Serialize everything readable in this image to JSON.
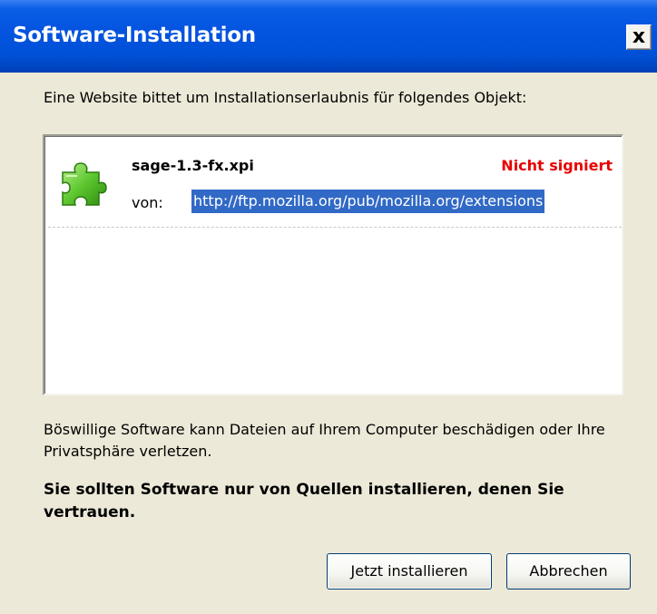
{
  "window": {
    "title": "Software-Installation",
    "close_glyph": "×",
    "close_label": "x"
  },
  "request": {
    "text": "Eine Website bittet um Installationserlaubnis für folgendes Objekt:"
  },
  "item": {
    "icon": "puzzle-piece-icon",
    "filename": "sage-1.3-fx.xpi",
    "status": "Nicht signiert",
    "status_color": "#e80000",
    "from_label": "von:",
    "url": "http://ftp.mozilla.org/pub/mozilla.org/extensions"
  },
  "warning": {
    "text": "Böswillige Software kann Dateien auf Ihrem Computer beschädigen oder Ihre Privatsphäre verletzen.",
    "trust_text": "Sie sollten Software nur von Quellen installieren, denen Sie vertrauen."
  },
  "buttons": {
    "install_label": "Jetzt installieren",
    "cancel_label": "Abbrechen"
  },
  "colors": {
    "titlebar": "#0454e0",
    "selection": "#3169c6",
    "dialog_bg": "#ece9d8"
  }
}
